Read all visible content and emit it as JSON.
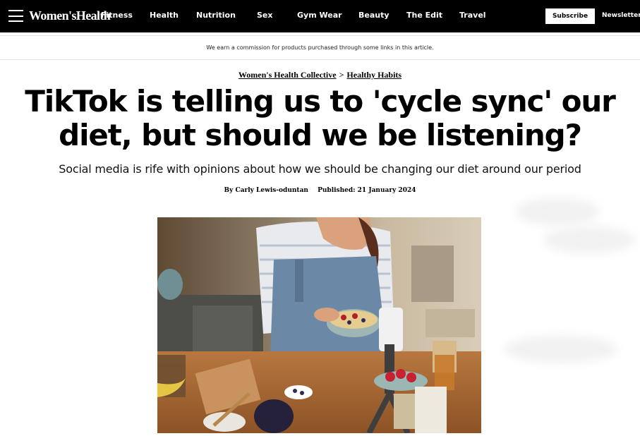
{
  "nav": {
    "logo": "Women'sHealth",
    "links": [
      "Fitness",
      "Health",
      "Nutrition",
      "Sex",
      "Gym Wear",
      "Beauty",
      "The Edit",
      "Travel"
    ],
    "subscribe_label": "Subscribe",
    "newsletter_label": "Newsletter"
  },
  "disclosure": "We earn a commission for products purchased through some links in this article.",
  "breadcrumb": {
    "parent": "Women's Health Collective",
    "separator": ">",
    "child": "Healthy Habits"
  },
  "article": {
    "headline": "TikTok is telling us to 'cycle sync' our diet, but should we be listening?",
    "dek": "Social media is rife with opinions about how we should be changing our diet around our period",
    "byline_prefix": "By",
    "author": "Carly Lewis-oduntan",
    "published_label": "Published:",
    "published_date": "21 January 2024"
  },
  "colors": {
    "nav_bg": "#000000",
    "nav_text": "#ffffff",
    "accent": "#000000"
  }
}
